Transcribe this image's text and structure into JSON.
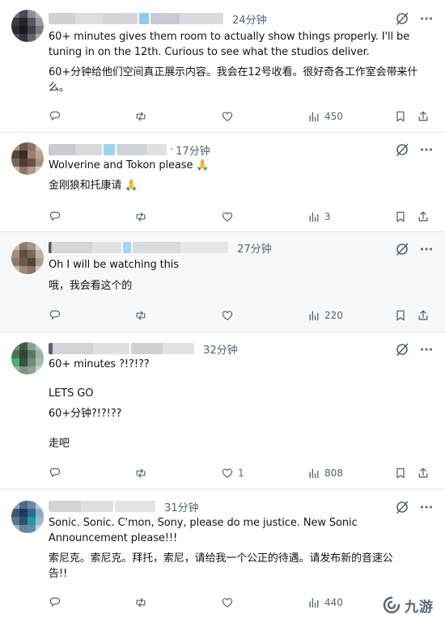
{
  "posts": [
    {
      "time": "24分钟",
      "text_en": "60+ minutes gives them room to actually show things properly. I'll be tuning in on the 12th. Curious to see what the studios deliver.",
      "text_cn": "60+分钟给他们空间真正展示内容。我会在12号收看。很好奇各工作室会带来什么。",
      "likes": "",
      "views": "450"
    },
    {
      "time": "17分钟",
      "text_en": "Wolverine and Tokon please 🙏",
      "text_cn": "金刚狼和托康请 🙏",
      "likes": "",
      "views": "3"
    },
    {
      "time": "27分钟",
      "text_en": "Oh I will be watching this",
      "text_cn": "哦，我会看这个的",
      "likes": "",
      "views": "220"
    },
    {
      "time": "32分钟",
      "text_en_1": "60+ minutes ?!?!??",
      "text_en_2": "LETS GO",
      "text_cn_1": "60+分钟?!?!??",
      "text_cn_2": "走吧",
      "likes": "1",
      "views": "808"
    },
    {
      "time": "31分钟",
      "text_en": "Sonic. Sonic. C'mon, Sony, please do me justice. New Sonic Announcement please!!!",
      "text_cn": "索尼克。索尼克。拜托，索尼，请给我一个公正的待遇。请发布新的音速公告!!",
      "likes": "",
      "views": "440"
    }
  ],
  "icons": {
    "reply": "reply-icon",
    "repost": "repost-icon",
    "like": "like-icon",
    "views": "views-icon",
    "bookmark": "bookmark-icon",
    "share": "share-icon",
    "grok": "grok-icon",
    "more": "more-icon"
  },
  "colors": {
    "icon_gray": "#536471",
    "divider": "#e3e6ea",
    "highlight_bg": "#f7f8f9"
  },
  "watermark": {
    "text": "九游"
  }
}
